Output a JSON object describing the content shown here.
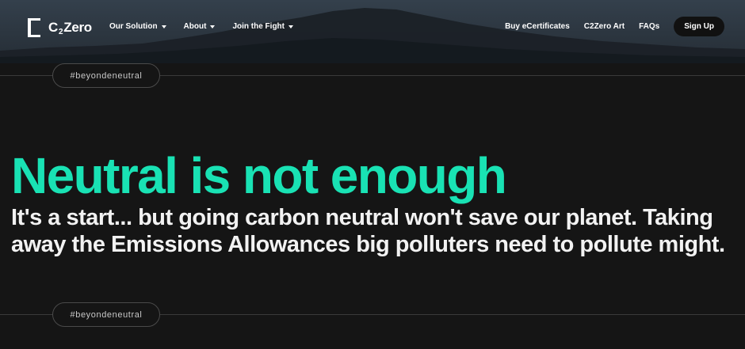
{
  "header": {
    "logo": {
      "prefix": "C",
      "subscript": "2",
      "suffix": "Zero"
    },
    "nav_left": [
      {
        "label": "Our Solution",
        "icon": "chevron-down-icon"
      },
      {
        "label": "About",
        "icon": "chevron-down-icon"
      },
      {
        "label": "Join the Fight",
        "icon": "chevron-down-icon"
      }
    ],
    "nav_right": [
      {
        "label": "Buy eCertificates"
      },
      {
        "label": "C2Zero Art"
      },
      {
        "label": "FAQs"
      }
    ],
    "signup_label": "Sign Up"
  },
  "tags": {
    "top": "#beyondeneutral",
    "bottom": "#beyondeneutral"
  },
  "hero": {
    "title": "Neutral is not enough",
    "subtitle": "It's a start... but going carbon neutral won't save our planet. Taking away the Emissions Allowances big polluters need to pollute might."
  },
  "colors": {
    "accent": "#19e2b4",
    "background": "#151515",
    "header_bg": "#29323b"
  }
}
